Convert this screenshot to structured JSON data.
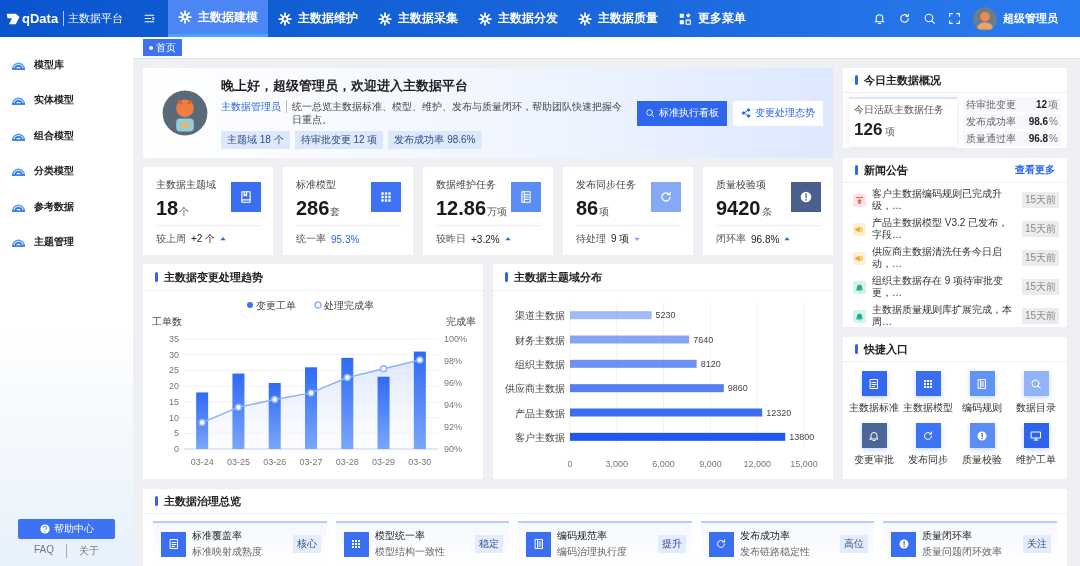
{
  "topbar": {
    "logo": "qData",
    "app_name": "主数据平台",
    "nav": [
      {
        "label": "主数据建模",
        "selected": true
      },
      {
        "label": "主数据维护",
        "selected": false
      },
      {
        "label": "主数据采集",
        "selected": false
      },
      {
        "label": "主数据分发",
        "selected": false
      },
      {
        "label": "主数据质量",
        "selected": false
      },
      {
        "label": "更多菜单",
        "selected": false
      }
    ],
    "user": "超级管理员"
  },
  "sidebar": {
    "items": [
      {
        "label": "模型库"
      },
      {
        "label": "实体模型"
      },
      {
        "label": "组合模型"
      },
      {
        "label": "分类模型"
      },
      {
        "label": "参考数据"
      },
      {
        "label": "主题管理"
      }
    ],
    "help_button": "帮助中心",
    "footer_links": [
      "FAQ",
      "关于"
    ]
  },
  "page_tabs": [
    {
      "label": "首页",
      "selected": true
    }
  ],
  "hero": {
    "greeting": "晚上好，超级管理员，欢迎进入主数据平台",
    "role": "主数据管理员",
    "description": "统一总览主数据标准、模型、维护、发布与质量闭环，帮助团队快速把握今日重点。",
    "tags": [
      "主题域 18 个",
      "待审批变更 12 项",
      "发布成功率 98.6%"
    ],
    "buttons": [
      {
        "label": "标准执行看板",
        "kind": "primary"
      },
      {
        "label": "变更处理态势",
        "kind": "secondary"
      }
    ]
  },
  "stats": [
    {
      "label": "主数据主题域",
      "value": "18",
      "unit": "个",
      "color": "#3b6ff2",
      "footer_label": "较上周",
      "footer_value": "+2 个",
      "kind": "up"
    },
    {
      "label": "标准模型",
      "value": "286",
      "unit": "套",
      "color": "#3f73f3",
      "footer_label": "统一率",
      "footer_value": "95.3%",
      "kind": "plain"
    },
    {
      "label": "数据维护任务",
      "value": "12.86",
      "unit": "万项",
      "color": "#5b8df5",
      "footer_label": "较昨日",
      "footer_value": "+3.2%",
      "kind": "up"
    },
    {
      "label": "发布同步任务",
      "value": "86",
      "unit": "项",
      "color": "#86a9f6",
      "footer_label": "待处理",
      "footer_value": "9 项",
      "kind": "down"
    },
    {
      "label": "质量校验项",
      "value": "9420",
      "unit": "条",
      "color": "#4a5f8c",
      "footer_label": "闭环率",
      "footer_value": "96.8%",
      "kind": "up"
    }
  ],
  "trend_panel": {
    "title": "主数据变更处理趋势",
    "chart_data": {
      "type": "bar",
      "ylabel": "工单数",
      "categories": [
        "03-24",
        "03-25",
        "03-26",
        "03-27",
        "03-28",
        "03-29",
        "03-30"
      ],
      "series": [
        {
          "name": "变更工单",
          "color": "#3a72f5",
          "values": [
            18,
            24,
            21,
            26,
            29,
            23,
            31
          ]
        }
      ],
      "ylim": [
        0,
        35
      ],
      "yticks": [
        0,
        5,
        10,
        15,
        20,
        25,
        30,
        35
      ],
      "grid": true,
      "legend": "top"
    },
    "rate_chart": {
      "chart_data": {
        "type": "area",
        "ylabel": "完成率",
        "series": [
          {
            "name": "处理完成率",
            "color": "#8fb3fb",
            "values": [
              92.4,
              93.8,
              94.5,
              95.1,
              96.5,
              97.3,
              98.1
            ]
          }
        ],
        "ylim": [
          90,
          100
        ],
        "yticks": [
          {
            "value": 90,
            "label": "90%"
          },
          {
            "value": 92,
            "label": "92%"
          },
          {
            "value": 94,
            "label": "94%"
          },
          {
            "value": 96,
            "label": "96%"
          },
          {
            "value": 98,
            "label": "98%"
          },
          {
            "value": 100,
            "label": "100%"
          }
        ],
        "legend": "top"
      }
    }
  },
  "domain_panel": {
    "chart_data": {
      "type": "bar",
      "orientation": "horizontal",
      "title": "主数据主题域分布",
      "categories": [
        "渠道主数据",
        "财务主数据",
        "组织主数据",
        "供应商主数据",
        "产品主数据",
        "客户主数据"
      ],
      "series": [
        {
          "color": "#2158ee",
          "values": [
            5230,
            7640,
            8120,
            9860,
            12320,
            13800
          ]
        }
      ],
      "xlim": [
        0,
        15000
      ],
      "xticks": [
        {
          "value": 0,
          "label": "0"
        },
        {
          "value": 3000,
          "label": "3,000"
        },
        {
          "value": 6000,
          "label": "6,000"
        },
        {
          "value": 9000,
          "label": "9,000"
        },
        {
          "value": 12000,
          "label": "12,000"
        },
        {
          "value": 15000,
          "label": "15,000"
        }
      ],
      "grid": true,
      "value_labels": [
        "5230",
        "7640",
        "8120",
        "9860",
        "12320",
        "13800"
      ]
    }
  },
  "overview": {
    "title": "今日主数据概况",
    "main": {
      "label": "今日活跃主数据任务",
      "value": "126",
      "unit": "项"
    },
    "metrics": [
      {
        "label": "待审批变更",
        "value": "12",
        "unit": "项"
      },
      {
        "label": "发布成功率",
        "value": "98.6",
        "unit": "%"
      },
      {
        "label": "质量通过率",
        "value": "96.8",
        "unit": "%"
      }
    ]
  },
  "news": {
    "title": "新闻公告",
    "more": "查看更多",
    "items": [
      {
        "text": "客户主数据编码规则已完成升级，…",
        "time": "15天前",
        "kind": "upgrade"
      },
      {
        "text": "产品主数据模型 V3.2 已发布，字段…",
        "time": "15天前",
        "kind": "speaker"
      },
      {
        "text": "供应商主数据清洗任务今日启动，…",
        "time": "15天前",
        "kind": "speaker"
      },
      {
        "text": "组织主数据存在 9 项待审批变更，…",
        "time": "15天前",
        "kind": "bell"
      },
      {
        "text": "主数据质量规则库扩展完成，本周…",
        "time": "15天前",
        "kind": "bell"
      }
    ]
  },
  "quick": {
    "title": "快捷入口",
    "items": [
      {
        "label": "主数据标准",
        "color": "#3568f0"
      },
      {
        "label": "主数据模型",
        "color": "#3b6ff2"
      },
      {
        "label": "编码规则",
        "color": "#6093f4"
      },
      {
        "label": "数据目录",
        "color": "#93b3f8"
      },
      {
        "label": "变更审批",
        "color": "#4c6797"
      },
      {
        "label": "发布同步",
        "color": "#3d74f3"
      },
      {
        "label": "质量校验",
        "color": "#5b8df5"
      },
      {
        "label": "维护工单",
        "color": "#2f63ee"
      }
    ]
  },
  "governance": {
    "title": "主数据治理总览",
    "cards": [
      {
        "title": "标准覆盖率",
        "subtitle": "标准映射成熟度",
        "badge": "核心"
      },
      {
        "title": "模型统一率",
        "subtitle": "模型结构一致性",
        "badge": "稳定"
      },
      {
        "title": "编码规范率",
        "subtitle": "编码治理执行度",
        "badge": "提升"
      },
      {
        "title": "发布成功率",
        "subtitle": "发布链路稳定性",
        "badge": "高位"
      },
      {
        "title": "质量闭环率",
        "subtitle": "质量问题闭环效率",
        "badge": "关注"
      }
    ]
  }
}
